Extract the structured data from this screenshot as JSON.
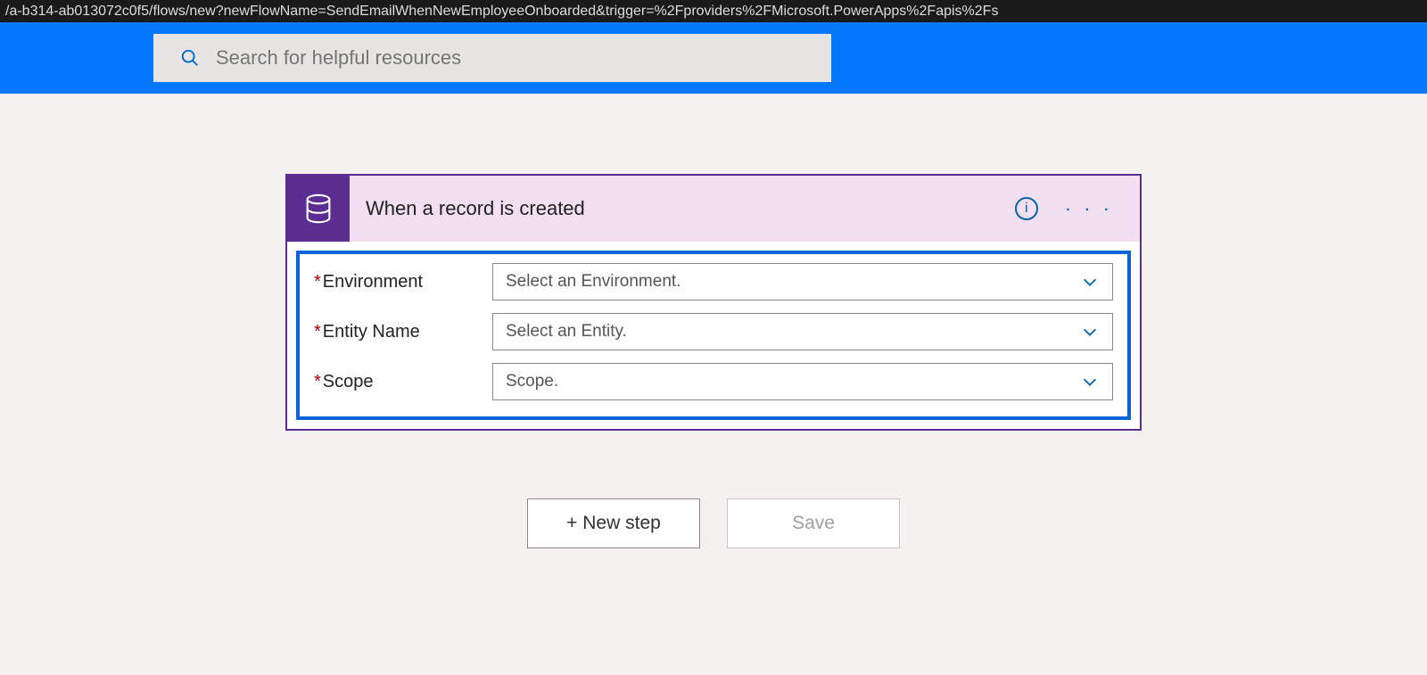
{
  "urlFragment": "/a-b314-ab013072c0f5/flows/new?newFlowName=SendEmailWhenNewEmployeeOnboarded&trigger=%2Fproviders%2FMicrosoft.PowerApps%2Fapis%2Fs",
  "search": {
    "placeholder": "Search for helpful resources"
  },
  "trigger": {
    "title": "When a record is created",
    "fields": [
      {
        "label": "Environment",
        "required": true,
        "placeholder": "Select an Environment."
      },
      {
        "label": "Entity Name",
        "required": true,
        "placeholder": "Select an Entity."
      },
      {
        "label": "Scope",
        "required": true,
        "placeholder": "Scope."
      }
    ]
  },
  "buttons": {
    "newStep": "+ New step",
    "save": "Save"
  },
  "infoGlyph": "i",
  "moreGlyph": "· · ·"
}
